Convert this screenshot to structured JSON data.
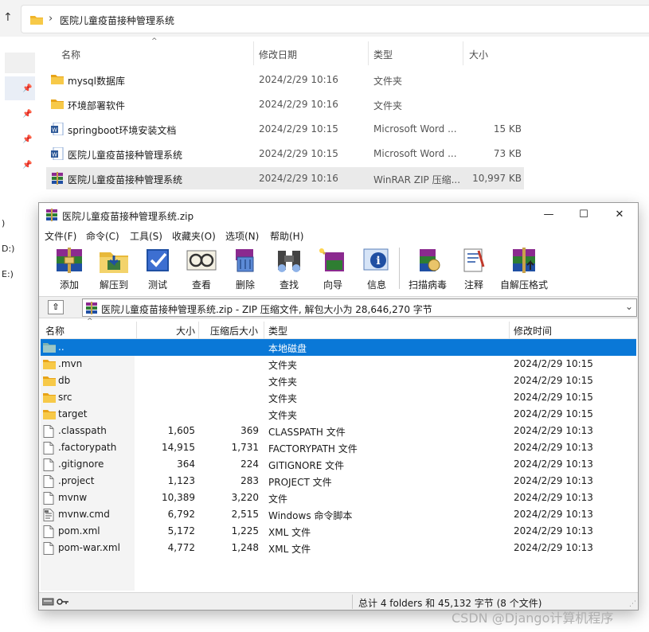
{
  "explorer": {
    "path": "医院儿童疫苗接种管理系统",
    "columns": {
      "name": "名称",
      "date": "修改日期",
      "type": "类型",
      "size": "大小"
    },
    "drives": [
      "D:)",
      "E:)"
    ],
    "drive_fragment": ")",
    "files": [
      {
        "name": "mysql数据库",
        "date": "2024/2/29 10:16",
        "type": "文件夹",
        "size": "",
        "icon": "folder-icon"
      },
      {
        "name": "环境部署软件",
        "date": "2024/2/29 10:16",
        "type": "文件夹",
        "size": "",
        "icon": "folder-icon"
      },
      {
        "name": "springboot环境安装文档",
        "date": "2024/2/29 10:15",
        "type": "Microsoft Word ...",
        "size": "15 KB",
        "icon": "word-icon"
      },
      {
        "name": "医院儿童疫苗接种管理系统",
        "date": "2024/2/29 10:15",
        "type": "Microsoft Word ...",
        "size": "73 KB",
        "icon": "word-icon"
      },
      {
        "name": "医院儿童疫苗接种管理系统",
        "date": "2024/2/29 10:16",
        "type": "WinRAR ZIP 压缩...",
        "size": "10,997 KB",
        "icon": "winrar-icon"
      }
    ]
  },
  "winrar": {
    "title": "医院儿童疫苗接种管理系统.zip",
    "window_buttons": {
      "minimize": "—",
      "maximize": "☐",
      "close": "✕"
    },
    "menu": [
      "文件(F)",
      "命令(C)",
      "工具(S)",
      "收藏夹(O)",
      "选项(N)",
      "帮助(H)"
    ],
    "toolbar": [
      "添加",
      "解压到",
      "测试",
      "查看",
      "删除",
      "查找",
      "向导",
      "信息",
      "扫描病毒",
      "注释",
      "自解压格式"
    ],
    "path_text": "医院儿童疫苗接种管理系统.zip - ZIP 压缩文件, 解包大小为 28,646,270 字节",
    "columns": {
      "name": "名称",
      "size": "大小",
      "packed": "压缩后大小",
      "type": "类型",
      "modified": "修改时间"
    },
    "rows": [
      {
        "name": "..",
        "size": "",
        "packed": "",
        "type": "本地磁盘",
        "modified": "",
        "kind": "drive"
      },
      {
        "name": ".mvn",
        "size": "",
        "packed": "",
        "type": "文件夹",
        "modified": "2024/2/29 10:15",
        "kind": "folder"
      },
      {
        "name": "db",
        "size": "",
        "packed": "",
        "type": "文件夹",
        "modified": "2024/2/29 10:15",
        "kind": "folder"
      },
      {
        "name": "src",
        "size": "",
        "packed": "",
        "type": "文件夹",
        "modified": "2024/2/29 10:15",
        "kind": "folder"
      },
      {
        "name": "target",
        "size": "",
        "packed": "",
        "type": "文件夹",
        "modified": "2024/2/29 10:15",
        "kind": "folder"
      },
      {
        "name": ".classpath",
        "size": "1,605",
        "packed": "369",
        "type": "CLASSPATH 文件",
        "modified": "2024/2/29 10:13",
        "kind": "file"
      },
      {
        "name": ".factorypath",
        "size": "14,915",
        "packed": "1,731",
        "type": "FACTORYPATH 文件",
        "modified": "2024/2/29 10:13",
        "kind": "file"
      },
      {
        "name": ".gitignore",
        "size": "364",
        "packed": "224",
        "type": "GITIGNORE 文件",
        "modified": "2024/2/29 10:13",
        "kind": "file"
      },
      {
        "name": ".project",
        "size": "1,123",
        "packed": "283",
        "type": "PROJECT 文件",
        "modified": "2024/2/29 10:13",
        "kind": "file"
      },
      {
        "name": "mvnw",
        "size": "10,389",
        "packed": "3,220",
        "type": "文件",
        "modified": "2024/2/29 10:13",
        "kind": "file"
      },
      {
        "name": "mvnw.cmd",
        "size": "6,792",
        "packed": "2,515",
        "type": "Windows 命令脚本",
        "modified": "2024/2/29 10:13",
        "kind": "script"
      },
      {
        "name": "pom.xml",
        "size": "5,172",
        "packed": "1,225",
        "type": "XML 文件",
        "modified": "2024/2/29 10:13",
        "kind": "file"
      },
      {
        "name": "pom-war.xml",
        "size": "4,772",
        "packed": "1,248",
        "type": "XML 文件",
        "modified": "2024/2/29 10:13",
        "kind": "file"
      }
    ],
    "status": "总计 4 folders 和 45,132 字节 (8 个文件)"
  },
  "watermark": "CSDN @Django计算机程序",
  "colors": {
    "selection": "#0a78d7",
    "folder": "#f0b429",
    "explorer_selected_row": "#eaeaea"
  }
}
